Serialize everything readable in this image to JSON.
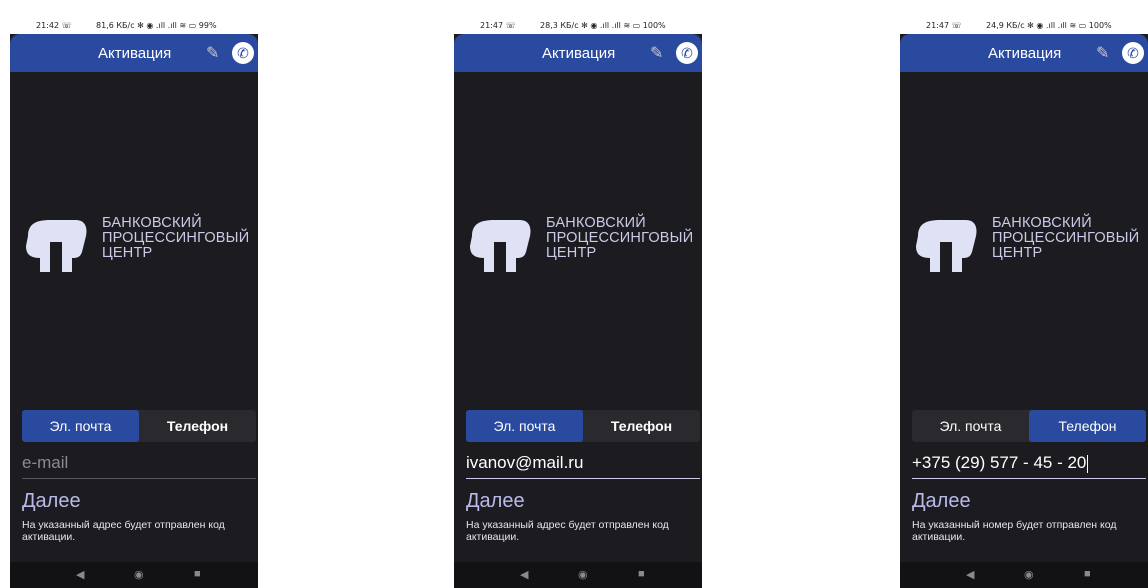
{
  "screens": [
    {
      "status": {
        "time": "21:42 ☏",
        "stats": "81,6 КБ/с ✻ ◉ .ıll .ıll ≋ ▭ 99%"
      },
      "appbar": {
        "title": "Активация"
      },
      "logo": {
        "line1": "БАНКОВСКИЙ",
        "line2": "ПРОЦЕССИНГОВЫЙ",
        "line3": "ЦЕНТР"
      },
      "tabs": {
        "email": "Эл. почта",
        "phone": "Телефон",
        "active": "email"
      },
      "field": {
        "value": "",
        "placeholder": "e-mail"
      },
      "next_label": "Далее",
      "hint": "На указанный адрес будет отправлен код активации."
    },
    {
      "status": {
        "time": "21:47 ☏",
        "stats": "28,3 КБ/с ✻ ◉ .ıll .ıll ≋ ▭ 100%"
      },
      "appbar": {
        "title": "Активация"
      },
      "logo": {
        "line1": "БАНКОВСКИЙ",
        "line2": "ПРОЦЕССИНГОВЫЙ",
        "line3": "ЦЕНТР"
      },
      "tabs": {
        "email": "Эл. почта",
        "phone": "Телефон",
        "active": "email"
      },
      "field": {
        "value": "ivanov@mail.ru",
        "placeholder": "e-mail"
      },
      "next_label": "Далее",
      "hint": "На указанный адрес будет отправлен код активации."
    },
    {
      "status": {
        "time": "21:47 ☏",
        "stats": "24,9 КБ/с ✻ ◉ .ıll .ıll ≋ ▭ 100%"
      },
      "appbar": {
        "title": "Активация"
      },
      "logo": {
        "line1": "БАНКОВСКИЙ",
        "line2": "ПРОЦЕССИНГОВЫЙ",
        "line3": "ЦЕНТР"
      },
      "tabs": {
        "email": "Эл. почта",
        "phone": "Телефон",
        "active": "phone"
      },
      "field": {
        "value": "+375 (29) 577 - 45 - 20",
        "placeholder": ""
      },
      "next_label": "Далее",
      "hint": "На указанный номер будет отправлен код активации."
    }
  ],
  "colors": {
    "appbar": "#2a4aa0",
    "background": "#1c1b1f",
    "accent_text": "#b8bbe8"
  },
  "icons": {
    "wrench": "wrench-icon",
    "call": "phone-call-icon",
    "nav_back": "back-triangle-icon",
    "nav_home": "home-circle-icon",
    "nav_recent": "recents-square-icon"
  }
}
